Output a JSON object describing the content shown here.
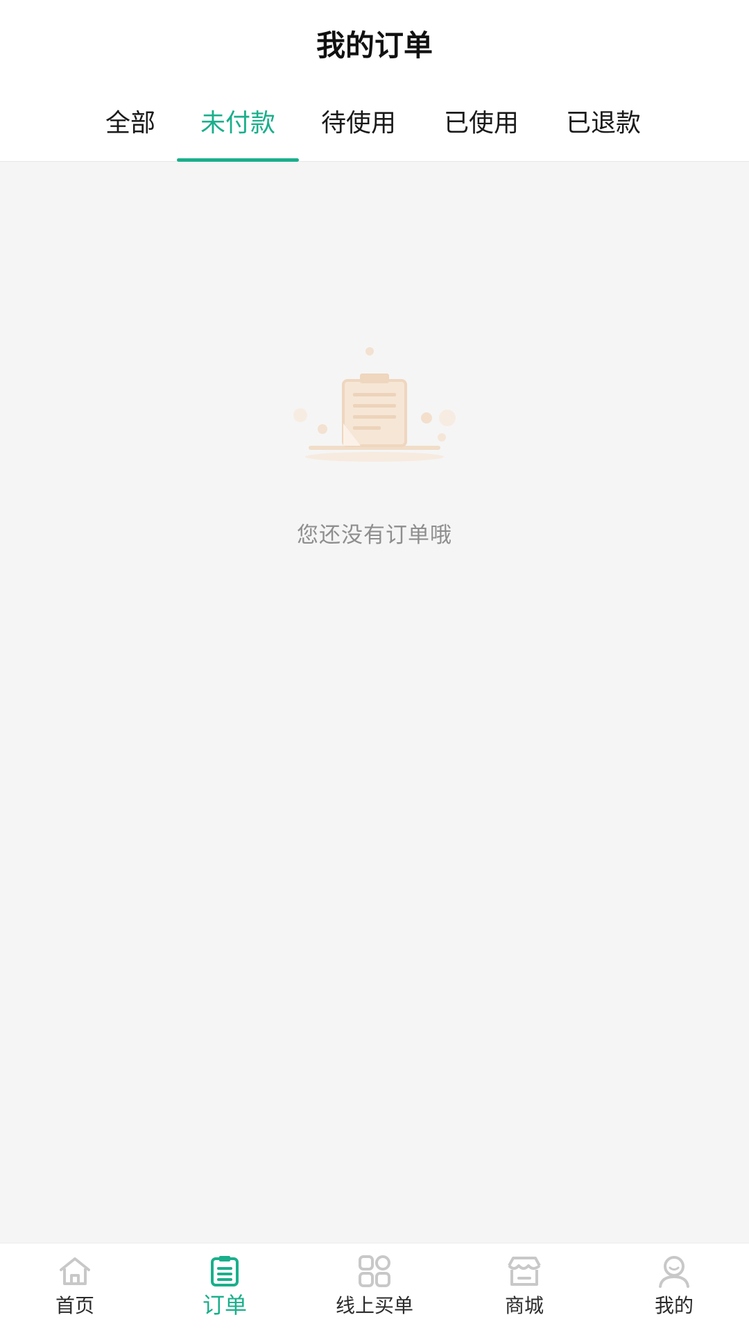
{
  "header": {
    "title": "我的订单"
  },
  "tabs": [
    {
      "label": "全部",
      "active": false
    },
    {
      "label": "未付款",
      "active": true
    },
    {
      "label": "待使用",
      "active": false
    },
    {
      "label": "已使用",
      "active": false
    },
    {
      "label": "已退款",
      "active": false
    }
  ],
  "empty_state": {
    "icon": "empty-orders-clipboard-icon",
    "message": "您还没有订单哦"
  },
  "bottom_nav": {
    "items": [
      {
        "label": "首页",
        "icon": "home-icon",
        "active": false
      },
      {
        "label": "订单",
        "icon": "clipboard-icon",
        "active": true
      },
      {
        "label": "线上买单",
        "icon": "grid-icon",
        "active": false
      },
      {
        "label": "商城",
        "icon": "store-icon",
        "active": false
      },
      {
        "label": "我的",
        "icon": "user-icon",
        "active": false
      }
    ]
  },
  "colors": {
    "accent": "#1aaf8b",
    "background": "#f5f5f5",
    "muted_text": "#8e8e8e",
    "inactive_icon": "#c8c8c8",
    "illustration": "#f1ddc8"
  }
}
